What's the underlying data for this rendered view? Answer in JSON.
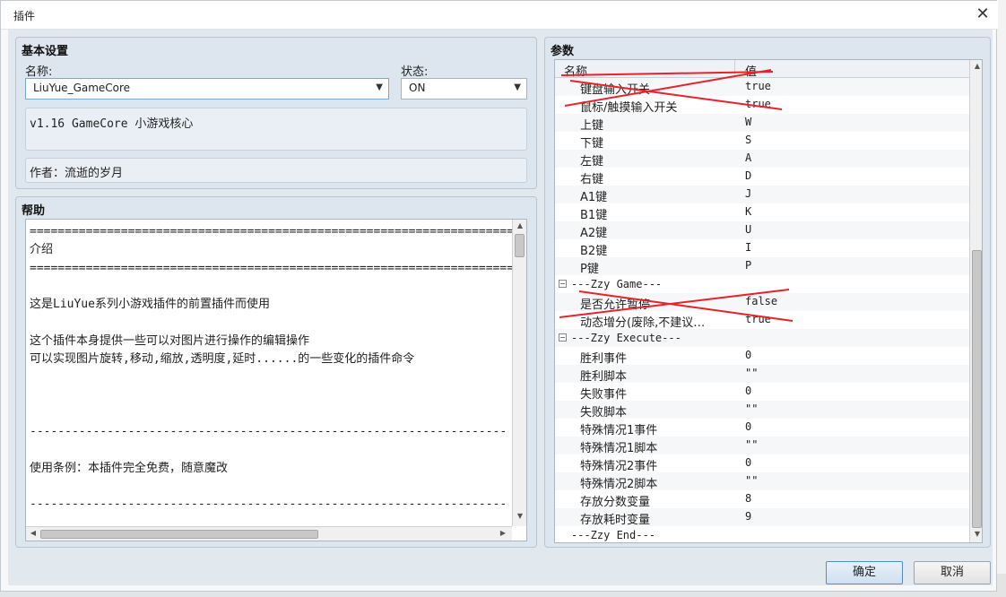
{
  "window": {
    "title": "插件",
    "close_glyph": "✕"
  },
  "basic": {
    "heading": "基本设置",
    "name_label": "名称:",
    "name_value": "LiuYue_GameCore",
    "status_label": "状态:",
    "status_value": "ON",
    "description": "v1.16 GameCore 小游戏核心",
    "author": "作者：流逝的岁月"
  },
  "help": {
    "heading": "帮助",
    "lines": [
      "============================================================================",
      "介绍",
      "============================================================================",
      "",
      "这是LiuYue系列小游戏插件的前置插件而使用",
      "",
      "这个插件本身提供一些可以对图片进行操作的编辑操作",
      "可以实现图片旋转,移动,缩放,透明度,延时......的一些变化的插件命令",
      "",
      "",
      "",
      "--------------------------------------------------------------------",
      "",
      "使用条例：本插件完全免费，随意魔改",
      "",
      "--------------------------------------------------------------------"
    ]
  },
  "params": {
    "heading": "参数",
    "col_name": "名称",
    "col_value": "值",
    "rows": [
      {
        "type": "param",
        "name": "键盘输入开关",
        "value": "true"
      },
      {
        "type": "param",
        "name": "鼠标/触摸输入开关",
        "value": "true"
      },
      {
        "type": "param",
        "name": "上键",
        "value": "W"
      },
      {
        "type": "param",
        "name": "下键",
        "value": "S"
      },
      {
        "type": "param",
        "name": "左键",
        "value": "A"
      },
      {
        "type": "param",
        "name": "右键",
        "value": "D"
      },
      {
        "type": "param",
        "name": "A1键",
        "value": "J"
      },
      {
        "type": "param",
        "name": "B1键",
        "value": "K"
      },
      {
        "type": "param",
        "name": "A2键",
        "value": "U"
      },
      {
        "type": "param",
        "name": "B2键",
        "value": "I"
      },
      {
        "type": "param",
        "name": "P键",
        "value": "P"
      },
      {
        "type": "group",
        "name": "---Zzy Game---",
        "toggle": "−"
      },
      {
        "type": "param",
        "name": "是否允许暂停",
        "value": "false"
      },
      {
        "type": "param",
        "name": "动态增分(废除,不建议…",
        "value": "true"
      },
      {
        "type": "group",
        "name": "---Zzy Execute---",
        "toggle": "−"
      },
      {
        "type": "param",
        "name": "胜利事件",
        "value": "0"
      },
      {
        "type": "param",
        "name": "胜利脚本",
        "value": "\"\""
      },
      {
        "type": "param",
        "name": "失败事件",
        "value": "0"
      },
      {
        "type": "param",
        "name": "失败脚本",
        "value": "\"\""
      },
      {
        "type": "param",
        "name": "特殊情况1事件",
        "value": "0"
      },
      {
        "type": "param",
        "name": "特殊情况1脚本",
        "value": "\"\""
      },
      {
        "type": "param",
        "name": "特殊情况2事件",
        "value": "0"
      },
      {
        "type": "param",
        "name": "特殊情况2脚本",
        "value": "\"\""
      },
      {
        "type": "param",
        "name": "存放分数变量",
        "value": "8"
      },
      {
        "type": "param",
        "name": "存放耗时变量",
        "value": "9"
      },
      {
        "type": "end",
        "name": "---Zzy End---"
      }
    ]
  },
  "buttons": {
    "ok": "确定",
    "cancel": "取消"
  },
  "scroll_glyphs": {
    "up": "▲",
    "down": "▼",
    "left": "◀",
    "right": "▶",
    "dropdown": "▼"
  },
  "colors": {
    "accent_border": "#5a8cc0",
    "strike": "#e8222a"
  }
}
